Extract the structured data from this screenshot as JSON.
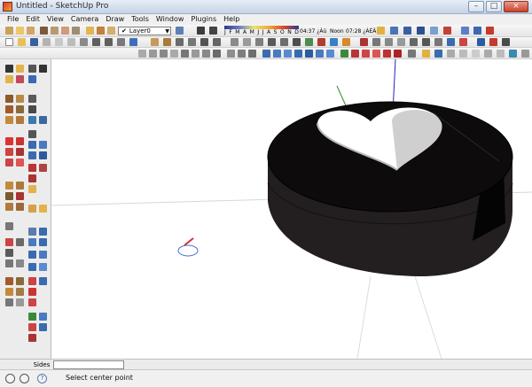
{
  "window": {
    "title": "Untitled - SketchUp Pro",
    "minimize": "–",
    "maximize": "□",
    "close": "×"
  },
  "menu": [
    "File",
    "Edit",
    "View",
    "Camera",
    "Draw",
    "Tools",
    "Window",
    "Plugins",
    "Help"
  ],
  "toolbar": {
    "layer_value": "Layer0",
    "layer_check": "✔",
    "shadow_months": [
      "J",
      "F",
      "M",
      "A",
      "M",
      "J",
      "J",
      "A",
      "S",
      "O",
      "N",
      "D"
    ],
    "time_start": "04:37 ¿Àü",
    "time_noon_label": "Noon",
    "time_end": "07:28 ¿ÀÈÄ"
  },
  "measurements": {
    "label": "Sides",
    "value": ""
  },
  "status": {
    "hint": "Select center point",
    "help_glyph": "?"
  },
  "colors": {
    "puck_top": "#0d0b0c",
    "puck_side": "#231e20",
    "heart_light": "#ffffff",
    "heart_shadow": "#b9b9b9",
    "axis_green": "#2a8a2a",
    "axis_blue": "#2222cc",
    "axis_red": "#cc2222"
  }
}
